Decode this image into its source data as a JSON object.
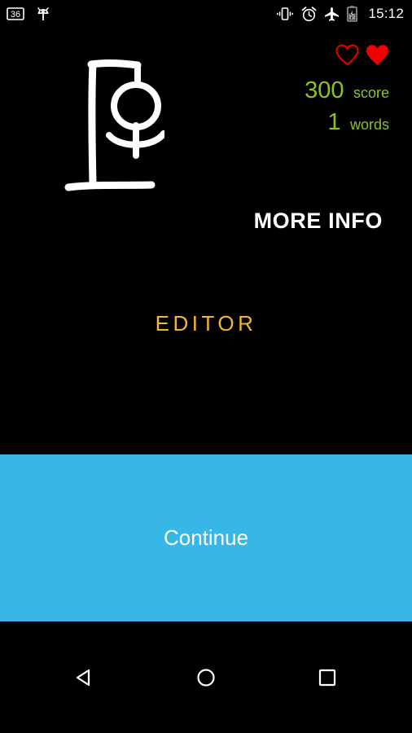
{
  "status_bar": {
    "left_icons": [
      {
        "name": "screenshot-count-icon",
        "label": "36"
      },
      {
        "name": "android-debug-icon",
        "label": ""
      }
    ],
    "right_icons": [
      {
        "name": "vibrate-icon",
        "label": ""
      },
      {
        "name": "alarm-clock-icon",
        "label": ""
      },
      {
        "name": "airplane-mode-icon",
        "label": ""
      },
      {
        "name": "battery-charging-icon",
        "label": ""
      }
    ],
    "clock": "15:12"
  },
  "game": {
    "hangman_alt": "hangman-gallows-drawing",
    "lives": {
      "total": 2,
      "remaining": 1,
      "heart_color": "#EE0000",
      "hearts": [
        {
          "name": "heart-empty-icon",
          "filled": false
        },
        {
          "name": "heart-filled-icon",
          "filled": true
        }
      ]
    },
    "stats": [
      {
        "value": "300",
        "label": "score"
      },
      {
        "value": "1",
        "label": "words"
      }
    ],
    "stats_color": "#8CC224",
    "more_info_label": "MORE INFO",
    "editor_label": "EDITOR",
    "editor_color": "#F2B630"
  },
  "continue": {
    "label": "Continue",
    "background_color": "#36B7E5",
    "text_color": "#FFFFFF"
  },
  "nav_bar": {
    "buttons": [
      {
        "name": "nav-back-button",
        "label": "Back"
      },
      {
        "name": "nav-home-button",
        "label": "Home"
      },
      {
        "name": "nav-recents-button",
        "label": "Recents"
      }
    ]
  }
}
